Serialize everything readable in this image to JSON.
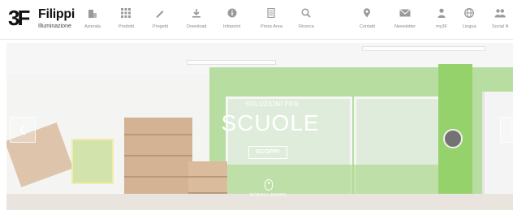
{
  "brand": {
    "mark": "3F",
    "name": "Filippi",
    "sub": "Illuminazione"
  },
  "nav": [
    {
      "label": "Azienda",
      "icon": "building-icon"
    },
    {
      "label": "Prodotti",
      "icon": "grid-icon"
    },
    {
      "label": "Progetti",
      "icon": "pencil-icon"
    },
    {
      "label": "Download",
      "icon": "download-icon"
    },
    {
      "label": "Infopoint",
      "icon": "info-icon"
    },
    {
      "label": "Press Area",
      "icon": "document-icon"
    },
    {
      "label": "Ricerca",
      "icon": "search-icon"
    },
    {
      "label": "Contatti",
      "icon": "map-pin-icon"
    },
    {
      "label": "Newsletter",
      "icon": "envelope-icon"
    },
    {
      "label": "my3F",
      "icon": "user-icon"
    },
    {
      "label": "Lingua",
      "icon": "globe-icon"
    },
    {
      "label": "Social N",
      "icon": "people-icon"
    }
  ],
  "hero": {
    "subtitle": "SOLUZIONI PER",
    "title": "SCUOLE",
    "cta": "SCOPRI",
    "scroll_label": "SCROLL DOWN",
    "prev_icon": "chevron-left-icon",
    "next_icon": "chevron-right-icon"
  },
  "colors": {
    "nav_icon": "#9a9a9a",
    "nav_text": "#8a8a8a",
    "wall_green": "#a9d68c",
    "brand_text": "#111111"
  }
}
